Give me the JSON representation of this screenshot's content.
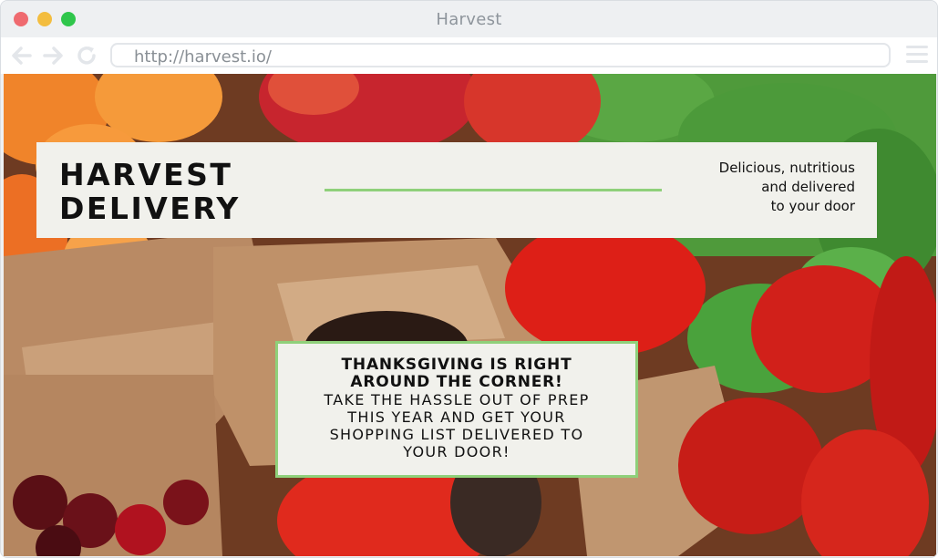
{
  "window": {
    "title": "Harvest"
  },
  "toolbar": {
    "url": "http://harvest.io/",
    "icons": [
      "back-arrow-icon",
      "forward-arrow-icon",
      "reload-icon",
      "hamburger-menu-icon"
    ]
  },
  "header": {
    "title": "HARVEST\nDELIVERY",
    "tagline": "Delicious, nutritious\nand delivered\nto your door"
  },
  "promo": {
    "heading": "THANKSGIVING IS RIGHT AROUND THE CORNER!",
    "body": "TAKE THE HASSLE OUT OF PREP THIS YEAR AND GET YOUR SHOPPING LIST DELIVERED TO YOUR DOOR!"
  },
  "colors": {
    "accent_green": "#8fd07a",
    "card_background": "#f1f1ec",
    "traffic_red": "#ef6a6f",
    "traffic_yellow": "#f3bd3f",
    "traffic_green": "#2fc64b"
  }
}
